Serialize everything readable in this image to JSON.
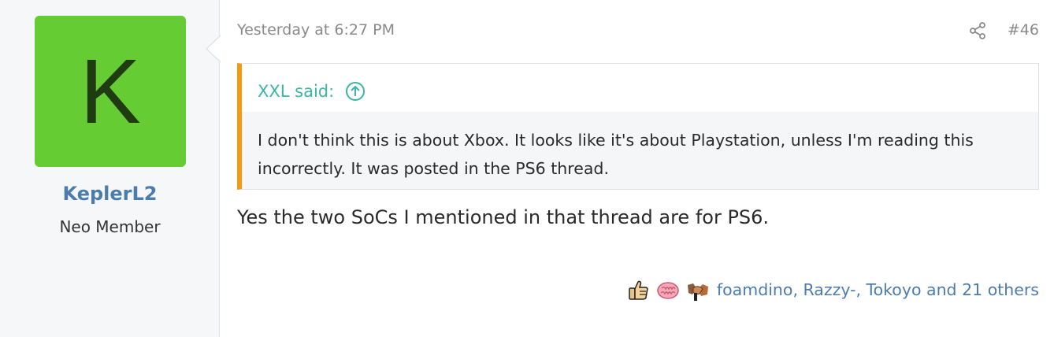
{
  "user": {
    "avatar_letter": "K",
    "avatar_bg": "#66cc33",
    "avatar_fg": "#1e3b12",
    "username": "KeplerL2",
    "username_color": "#4c7cac",
    "title": "Neo Member"
  },
  "post": {
    "date": "Yesterday at 6:27 PM",
    "number": "#46",
    "share_icon": "share-icon",
    "body": "Yes the two SoCs I mentioned in that thread are for PS6."
  },
  "quote": {
    "author_label": "XXL said:",
    "jump_icon": "arrow-up-circle-icon",
    "text": "I don't think this is about Xbox. It looks like it's about Playstation, unless I'm reading this incorrectly. It was posted in the PS6 thread.",
    "accent_color": "#f59b12",
    "link_color": "#3ab5a6"
  },
  "reactions": {
    "icons": [
      "thumbs-up-icon",
      "brain-icon",
      "handshake-icon"
    ],
    "summary": "foamdino, Razzy-, Tokoyo and 21 others",
    "link_color": "#4c7cac"
  }
}
